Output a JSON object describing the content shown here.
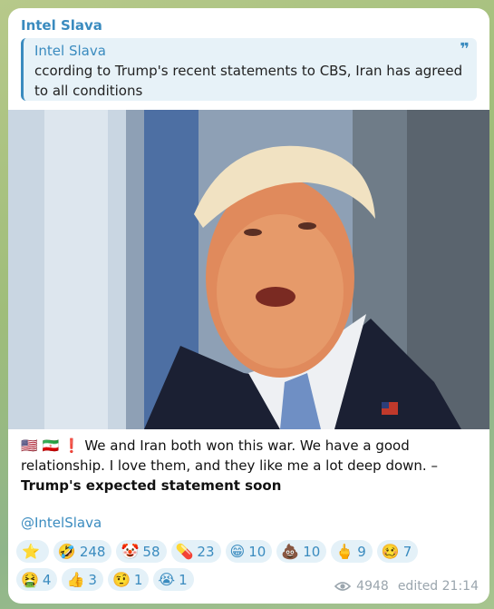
{
  "post": {
    "channel_name": "Intel Slava",
    "reply": {
      "title": "Intel Slava",
      "text": "ccording to Trump's recent statements to CBS, Iran has agreed to all conditions"
    },
    "flags": "🇺🇸 🇮🇷 ❗",
    "body": "We and Iran both won this war. We have a good relationship. I love them, and they like me a lot deep down. –",
    "body_bold": "Trump's expected statement soon",
    "handle": "@IntelSlava",
    "views": "4948",
    "edited": "edited 21:14"
  },
  "reactions": {
    "row1": [
      {
        "emoji": "⭐",
        "count": ""
      },
      {
        "emoji": "🤣",
        "count": "248"
      },
      {
        "emoji": "🤡",
        "count": "58"
      },
      {
        "emoji": "💊",
        "count": "23"
      },
      {
        "emoji": "😁",
        "count": "10"
      },
      {
        "emoji": "💩",
        "count": "10"
      },
      {
        "emoji": "🖕",
        "count": "9"
      },
      {
        "emoji": "🥴",
        "count": "7"
      }
    ],
    "row2": [
      {
        "emoji": "🤮",
        "count": "4"
      },
      {
        "emoji": "👍",
        "count": "3"
      },
      {
        "emoji": "🤨",
        "count": "1"
      },
      {
        "emoji": "😭",
        "count": "1"
      }
    ]
  }
}
